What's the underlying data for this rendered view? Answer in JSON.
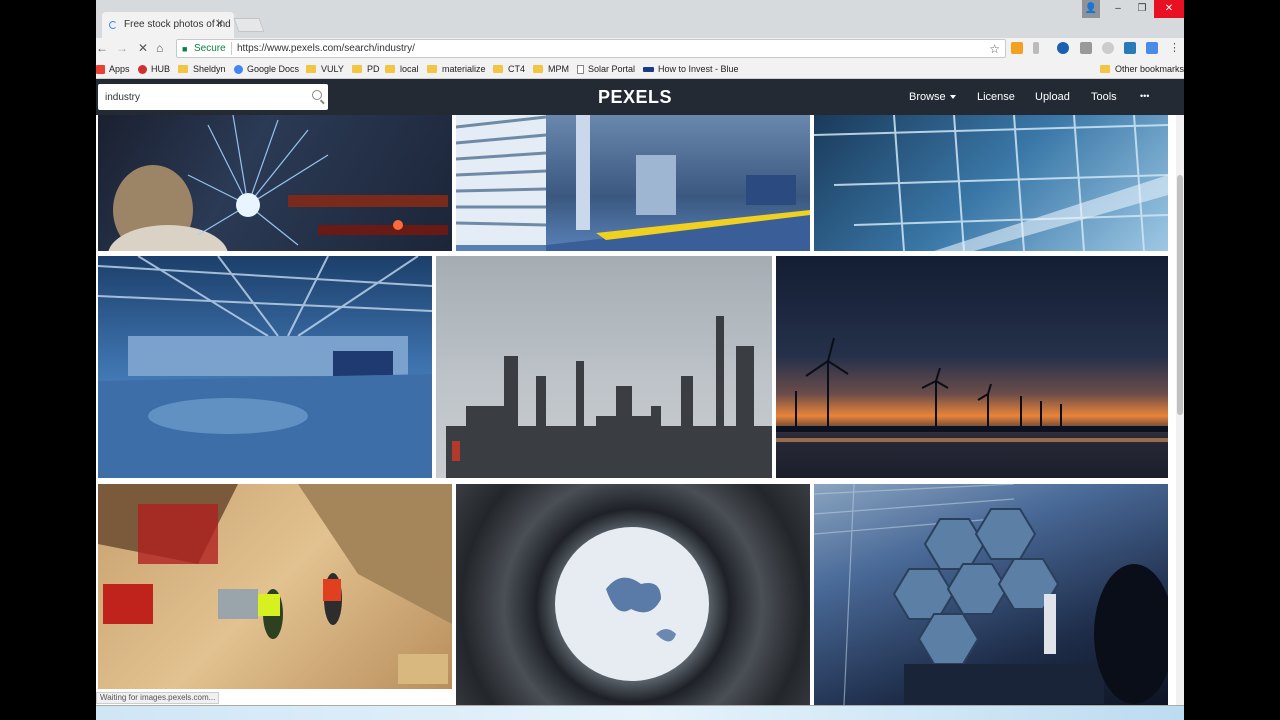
{
  "browser": {
    "tab_title": "Free stock photos of ind",
    "tab_close": "✕",
    "window_controls": {
      "minimize": "–",
      "maximize": "❐",
      "close": "✕",
      "user": "👤"
    },
    "nav": {
      "back": "←",
      "forward": "→",
      "stop": "✕",
      "home": "⌂"
    },
    "security_label": "Secure",
    "url": "https://www.pexels.com/search/industry/",
    "bookmark_star": "☆",
    "menu": "⋮",
    "bookmarks": [
      {
        "label": "Apps",
        "icon": "apps-grid-icon",
        "color": "#e94235"
      },
      {
        "label": "HUB",
        "icon": "hub-icon",
        "color": "#d32f2f"
      },
      {
        "label": "Sheldyn",
        "icon": "folder-icon",
        "color": "#f4c542"
      },
      {
        "label": "Google Docs",
        "icon": "google-icon",
        "color": "#4285f4"
      },
      {
        "label": "VULY",
        "icon": "folder-icon",
        "color": "#f4c542"
      },
      {
        "label": "PD",
        "icon": "folder-icon",
        "color": "#f4c542"
      },
      {
        "label": "local",
        "icon": "folder-icon",
        "color": "#f4c542"
      },
      {
        "label": "materialize",
        "icon": "folder-icon",
        "color": "#f4c542"
      },
      {
        "label": "CT4",
        "icon": "folder-icon",
        "color": "#f4c542"
      },
      {
        "label": "MPM",
        "icon": "folder-icon",
        "color": "#f4c542"
      },
      {
        "label": "Solar Portal",
        "icon": "page-icon",
        "color": "#888888"
      },
      {
        "label": "How to Invest - Blue",
        "icon": "link-icon",
        "color": "#1a3a8a"
      }
    ],
    "other_bookmarks": "Other bookmarks",
    "status_text": "Waiting for images.pexels.com..."
  },
  "pexels": {
    "search_value": "industry",
    "logo": "PEXELS",
    "nav": {
      "browse": "Browse",
      "license": "License",
      "upload": "Upload",
      "tools": "Tools",
      "more": "•••"
    }
  },
  "photos": [
    {
      "name": "welding-sparks-photo"
    },
    {
      "name": "warehouse-loading-dock-photo"
    },
    {
      "name": "glass-building-interior-photo"
    },
    {
      "name": "empty-warehouse-hall-photo"
    },
    {
      "name": "refinery-towers-photo"
    },
    {
      "name": "wind-turbines-sunset-photo"
    },
    {
      "name": "construction-workers-photo"
    },
    {
      "name": "circular-facade-sky-photo"
    },
    {
      "name": "hexagon-mirrors-telescope-photo"
    }
  ],
  "colors": {
    "header_bg": "#232a34",
    "accent_green": "#0b8043"
  }
}
